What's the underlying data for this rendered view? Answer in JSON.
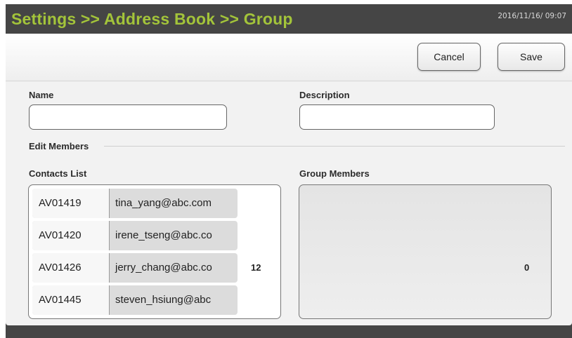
{
  "header": {
    "title": "Settings >> Address Book >> Group",
    "datetime": "2016/11/16/ 09:07"
  },
  "toolbar": {
    "cancel_label": "Cancel",
    "save_label": "Save"
  },
  "form": {
    "name_label": "Name",
    "name_value": "",
    "description_label": "Description",
    "description_value": "",
    "edit_members_label": "Edit Members"
  },
  "contacts": {
    "label": "Contacts List",
    "count": "12",
    "items": [
      {
        "id": "AV01419",
        "email": "tina_yang@abc.com"
      },
      {
        "id": "AV01420",
        "email": "irene_tseng@abc.co"
      },
      {
        "id": "AV01426",
        "email": "jerry_chang@abc.co"
      },
      {
        "id": "AV01445",
        "email": "steven_hsiung@abc"
      }
    ]
  },
  "members": {
    "label": "Group Members",
    "count": "0"
  },
  "colors": {
    "title": "#a3c43a",
    "frame": "#454545",
    "panel": "#f2f2f2"
  }
}
